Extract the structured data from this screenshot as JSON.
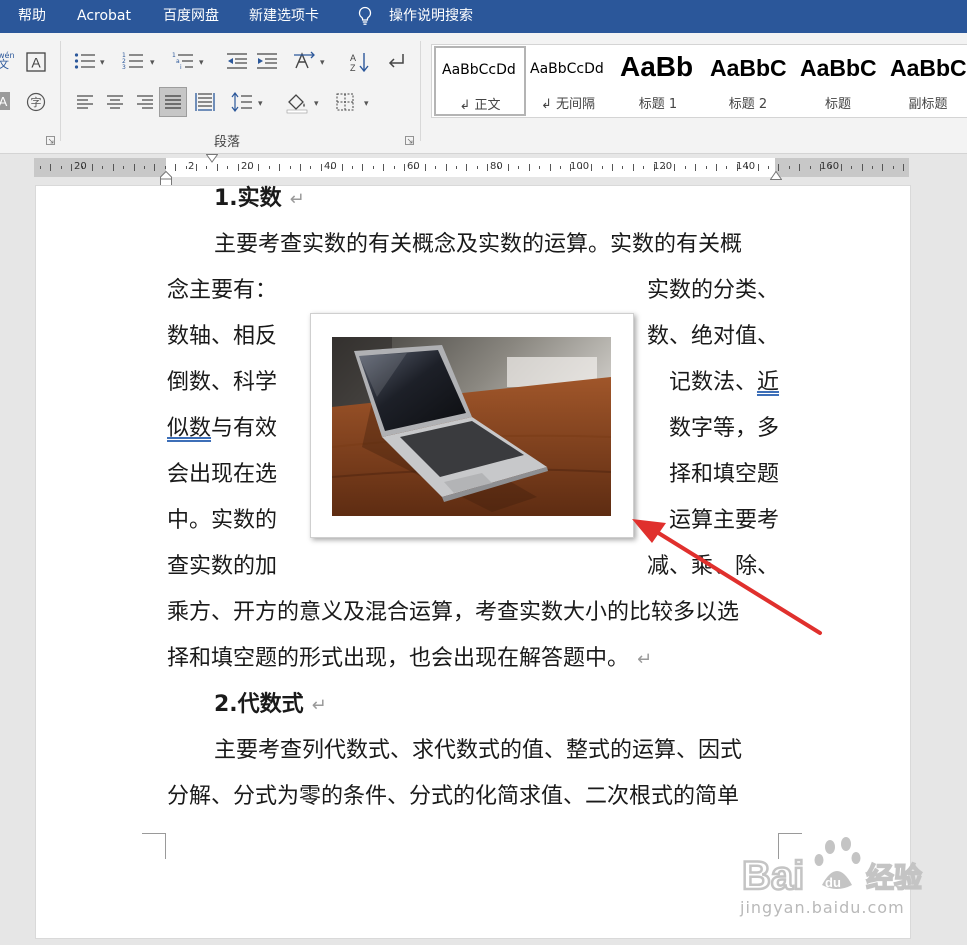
{
  "menu": {
    "items": [
      "帮助",
      "Acrobat",
      "百度网盘",
      "新建选项卡"
    ],
    "search_label": "操作说明搜索"
  },
  "ribbon": {
    "font_partial": {
      "phonetic": "wén",
      "char": "文"
    },
    "paragraph_group_label": "段落",
    "styles": [
      {
        "preview": "AaBbCcDd",
        "name": "↲ 正文"
      },
      {
        "preview": "AaBbCcDd",
        "name": "↲ 无间隔"
      },
      {
        "preview": "AaBb",
        "name": "标题 1"
      },
      {
        "preview": "AaBbC",
        "name": "标题 2"
      },
      {
        "preview": "AaBbC",
        "name": "标题"
      },
      {
        "preview": "AaBbCc",
        "name": "副标题"
      }
    ]
  },
  "ruler": {
    "labels": [
      "20",
      "2",
      "20",
      "40",
      "60",
      "80",
      "100",
      "120",
      "140",
      "160"
    ]
  },
  "document": {
    "heading1": "1.实数",
    "heading2": "2.代数式",
    "para1": {
      "l1": "主要考查实数的有关概念及实数的运算。实数的有关概",
      "l2a": "念主要有：",
      "l2b": "实数的分类、",
      "l3a": "数轴、相反",
      "l3b": "数、绝对值、",
      "l4a": "倒数、科学",
      "l4b": "记数法、",
      "l4c": "近",
      "l5a": "似数",
      "l5b": "与有效",
      "l5c": "数字等，多",
      "l6a": "会出现在选",
      "l6b": "择和填空题",
      "l7a": "中。实数的",
      "l7b": "运算主要考",
      "l8a": "查实数的加",
      "l8b": "减、乘、除、",
      "l9": "乘方、开方的意义及混合运算，考查实数大小的比较多以选",
      "l10": "择和填空题的形式出现，也会出现在解答题中。"
    },
    "para2": {
      "l1": "主要考查列代数式、求代数式的值、整式的运算、因式",
      "l2": "分解、分式为零的条件、分式的化简求值、二次根式的简单"
    },
    "paragraph_mark": "↵"
  },
  "watermark": {
    "text": "Bai 经验",
    "url": "jingyan.baidu.com"
  },
  "colors": {
    "menubar": "#2b579a",
    "arrow": "#e0302d",
    "underline": "#3d6fb8"
  }
}
